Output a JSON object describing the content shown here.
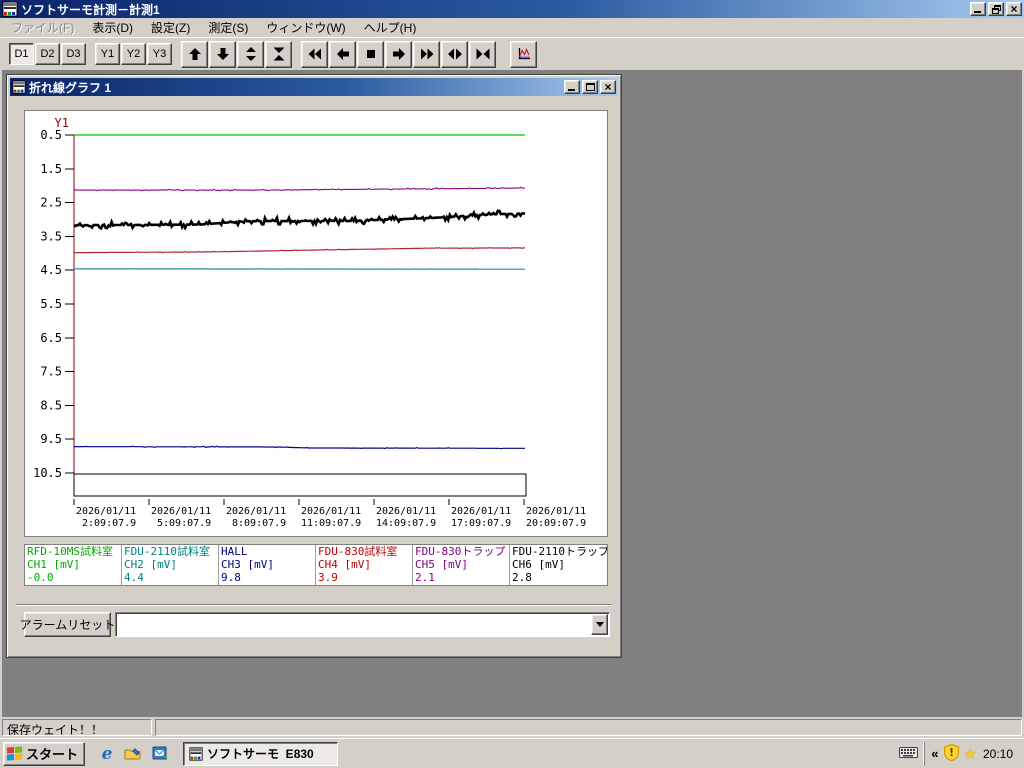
{
  "main_window": {
    "title": "ソフトサーモ計測－計測1",
    "menu": [
      {
        "label": "ファイル(F)",
        "disabled": true
      },
      {
        "label": "表示(D)",
        "disabled": false
      },
      {
        "label": "設定(Z)",
        "disabled": false
      },
      {
        "label": "測定(S)",
        "disabled": false
      },
      {
        "label": "ウィンドウ(W)",
        "disabled": false
      },
      {
        "label": "ヘルプ(H)",
        "disabled": false
      }
    ],
    "toolbar": {
      "display_buttons": [
        {
          "label": "D1",
          "pressed": true
        },
        {
          "label": "D2",
          "pressed": false
        },
        {
          "label": "D3",
          "pressed": false
        }
      ],
      "axis_buttons": [
        {
          "label": "Y1",
          "pressed": false
        },
        {
          "label": "Y2",
          "pressed": false
        },
        {
          "label": "Y3",
          "pressed": false
        }
      ],
      "scale_icon_buttons": [
        "arrow-up",
        "arrow-down",
        "expand-vertical",
        "compress-vertical"
      ],
      "scroll_icon_buttons": [
        "fast-rewind",
        "arrow-left",
        "stop",
        "arrow-right",
        "fast-forward",
        "expand-horizontal",
        "collapse-horizontal"
      ],
      "graph_icon_button": "line-graph"
    }
  },
  "graph_window": {
    "title": "折れ線グラフ 1"
  },
  "chart_data": {
    "type": "line",
    "title": "折れ線グラフ 1",
    "y_axis_name": "Y1",
    "y_ticks": [
      "0.5",
      "1.5",
      "2.5",
      "3.5",
      "4.5",
      "5.5",
      "6.5",
      "7.5",
      "8.5",
      "9.5",
      "10.5"
    ],
    "y_min": 0.5,
    "y_max": 10.5,
    "y_increases_downward": true,
    "grid": "off",
    "x_tick_labels": [
      {
        "date": "2026/01/11",
        "time": " 2:09:07.9"
      },
      {
        "date": "2026/01/11",
        "time": " 5:09:07.9"
      },
      {
        "date": "2026/01/11",
        "time": " 8:09:07.9"
      },
      {
        "date": "2026/01/11",
        "time": "11:09:07.9"
      },
      {
        "date": "2026/01/11",
        "time": "14:09:07.9"
      },
      {
        "date": "2026/01/11",
        "time": "17:09:07.9"
      },
      {
        "date": "2026/01/11",
        "time": "20:09:07.9"
      }
    ],
    "axis_color": "#8b0000",
    "series": [
      {
        "channel": "CH1",
        "device": "RFD-10MS試料室",
        "ch_label": "CH1 [mV]",
        "value": "-0.0",
        "line_color": "#00c400",
        "text_color": "#00a800",
        "width": 1.3,
        "noise": 0,
        "spike_prob": 0,
        "clipped_at_top": true,
        "anchors": [
          [
            0,
            0.5
          ],
          [
            1,
            0.5
          ]
        ]
      },
      {
        "channel": "CH2",
        "device": "FDU-2110試料室",
        "ch_label": "CH2 [mV]",
        "value": "4.4",
        "line_color": "#1e8cab",
        "text_color": "#008080",
        "width": 1.2,
        "noise": 0.012,
        "spike_prob": 0.1,
        "clipped_at_top": false,
        "anchors": [
          [
            0,
            4.46
          ],
          [
            1,
            4.47
          ]
        ]
      },
      {
        "channel": "CH3",
        "device": "HALL",
        "ch_label": "CH3 [mV]",
        "value": "9.8",
        "line_color": "#00008b",
        "text_color": "#000080",
        "width": 1.2,
        "noise": 0.02,
        "spike_prob": 0.12,
        "clipped_at_top": false,
        "anchors": [
          [
            0,
            9.72
          ],
          [
            0.45,
            9.73
          ],
          [
            0.52,
            9.76
          ],
          [
            1,
            9.77
          ]
        ]
      },
      {
        "channel": "CH4",
        "device": "FDU-830試料室",
        "ch_label": "CH4 [mV]",
        "value": "3.9",
        "line_color": "#b22437",
        "text_color": "#c00000",
        "width": 1.2,
        "noise": 0.015,
        "spike_prob": 0.15,
        "clipped_at_top": false,
        "anchors": [
          [
            0,
            3.98
          ],
          [
            0.3,
            3.96
          ],
          [
            0.55,
            3.9
          ],
          [
            0.78,
            3.85
          ],
          [
            1,
            3.84
          ]
        ]
      },
      {
        "channel": "CH5",
        "device": "FDU-830トラップ",
        "ch_label": "CH5 [mV]",
        "value": "2.1",
        "line_color": "#8b008b",
        "text_color": "#800080",
        "width": 1.1,
        "noise": 0.025,
        "spike_prob": 0.2,
        "clipped_at_top": false,
        "anchors": [
          [
            0,
            2.13
          ],
          [
            0.4,
            2.13
          ],
          [
            0.7,
            2.1
          ],
          [
            1,
            2.07
          ]
        ]
      },
      {
        "channel": "CH6",
        "device": "FDU-2110トラップ",
        "ch_label": "CH6 [mV]",
        "value": "2.8",
        "line_color": "#000000",
        "text_color": "#000000",
        "width": 2.6,
        "noise": 0.1,
        "spike_prob": 0.4,
        "clipped_at_top": false,
        "anchors": [
          [
            0,
            3.17
          ],
          [
            0.28,
            3.15
          ],
          [
            0.38,
            3.05
          ],
          [
            0.62,
            3.04
          ],
          [
            0.8,
            2.95
          ],
          [
            0.92,
            2.85
          ],
          [
            1,
            2.82
          ]
        ]
      }
    ]
  },
  "alarm_bar": {
    "reset_button": "アラームリセット",
    "message_combo_value": ""
  },
  "status_bar": {
    "left_text": "保存ウェイト！！",
    "right_text": ""
  },
  "taskbar": {
    "start_button": "スタート",
    "quick_launch_icons": [
      "internet-explorer",
      "show-desktop",
      "outlook-express"
    ],
    "task_button_label": "ソフトサーモ  E830",
    "tray": {
      "chevron": "«",
      "clock": "20:10"
    }
  }
}
